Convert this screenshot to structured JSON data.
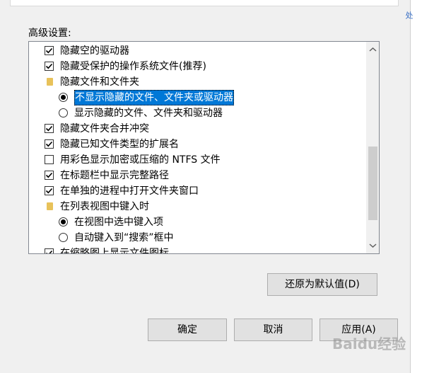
{
  "advanced": {
    "group_label": "高级设置:",
    "items": [
      {
        "type": "checkbox",
        "checked": true,
        "indent": 0,
        "label": "隐藏空的驱动器"
      },
      {
        "type": "checkbox",
        "checked": true,
        "indent": 0,
        "label": "隐藏受保护的操作系统文件(推荐)"
      },
      {
        "type": "folder",
        "indent": 0,
        "label": "隐藏文件和文件夹"
      },
      {
        "type": "radio",
        "checked": true,
        "indent": 1,
        "selected": true,
        "label": "不显示隐藏的文件、文件夹或驱动器"
      },
      {
        "type": "radio",
        "checked": false,
        "indent": 1,
        "label": "显示隐藏的文件、文件夹和驱动器"
      },
      {
        "type": "checkbox",
        "checked": true,
        "indent": 0,
        "label": "隐藏文件夹合并冲突"
      },
      {
        "type": "checkbox",
        "checked": true,
        "indent": 0,
        "label": "隐藏已知文件类型的扩展名"
      },
      {
        "type": "checkbox",
        "checked": false,
        "indent": 0,
        "label": "用彩色显示加密或压缩的 NTFS 文件"
      },
      {
        "type": "checkbox",
        "checked": true,
        "indent": 0,
        "label": "在标题栏中显示完整路径"
      },
      {
        "type": "checkbox",
        "checked": true,
        "indent": 0,
        "label": "在单独的进程中打开文件夹窗口"
      },
      {
        "type": "folder",
        "indent": 0,
        "label": "在列表视图中键入时"
      },
      {
        "type": "radio",
        "checked": true,
        "indent": 1,
        "label": "在视图中选中键入项"
      },
      {
        "type": "radio",
        "checked": false,
        "indent": 1,
        "label": "自动键入到“搜索”框中"
      },
      {
        "type": "checkbox",
        "checked": true,
        "indent": 0,
        "label": "在缩略图上显示文件图标"
      }
    ]
  },
  "buttons": {
    "restore_defaults": "还原为默认值(D)",
    "ok": "确定",
    "cancel": "取消",
    "apply": "应用(A)"
  },
  "side_text": "处",
  "watermark": "Baidu经验"
}
